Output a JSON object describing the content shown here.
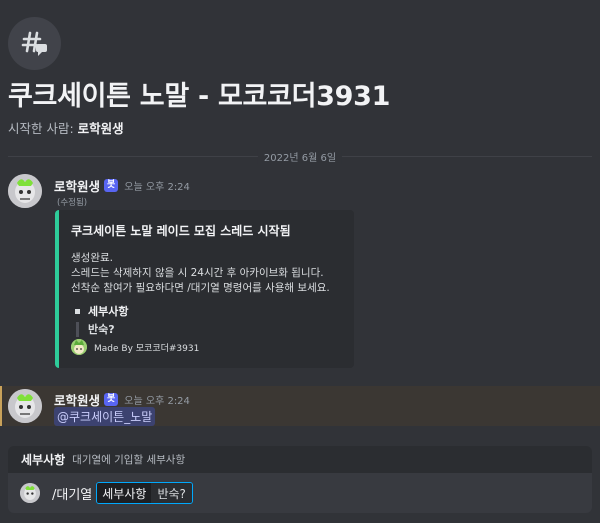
{
  "thread": {
    "title": "쿠크세이튼 노말 - 모코코더3931",
    "started_by_label": "시작한 사람: ",
    "started_by_name": "로학원생",
    "date_divider": "2022년 6월 6일",
    "icon": "thread-hash-icon"
  },
  "messages": [
    {
      "author": "로학원생",
      "badge": "봇",
      "timestamp": "오늘 오후 2:24",
      "edited": "(수정됨)",
      "embed": {
        "accent_color": "#2ecc9a",
        "title": "쿠크세이튼 노말 레이드 모집 스레드 시작됨",
        "description": [
          "생성완료.",
          "스레드는 삭제하지 않을 시 24시간 후 아카이브화 됩니다.",
          "선착순 참여가 필요하다면 /대기열 명령어를 사용해 보세요."
        ],
        "field_name": "세부사항",
        "field_value": "반숙?",
        "footer": "Made By 모코코더#3931"
      }
    },
    {
      "author": "로학원생",
      "badge": "봇",
      "timestamp": "오늘 오후 2:24",
      "mention": "@쿠크세이튼_노말"
    }
  ],
  "command_option": {
    "name": "세부사항",
    "description": "대기열에 기입할 세부사항"
  },
  "input": {
    "command": "/대기열",
    "option_key": "세부사항",
    "option_value": "반숙?"
  }
}
